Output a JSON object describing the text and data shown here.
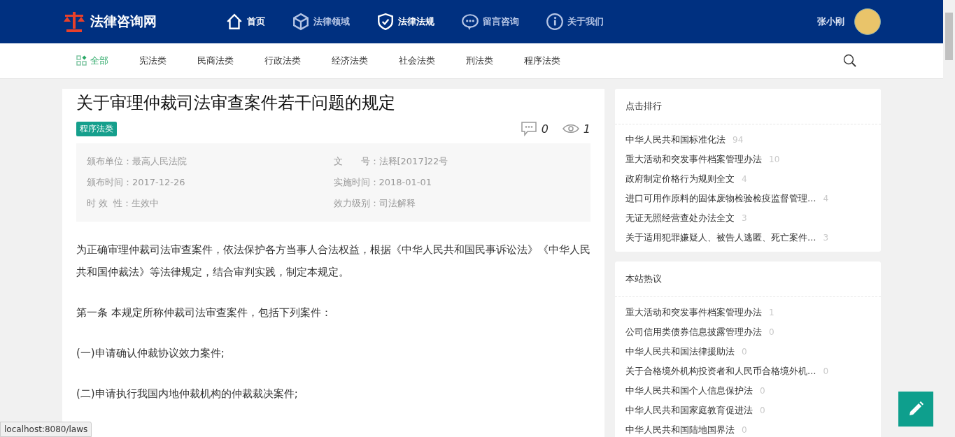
{
  "header": {
    "logo": "法律咨询网",
    "nav": [
      {
        "label": "首页",
        "selected": true
      },
      {
        "label": "法律领域",
        "selected": false
      },
      {
        "label": "法律法规",
        "selected": true
      },
      {
        "label": "留言咨询",
        "selected": false
      },
      {
        "label": "关于我们",
        "selected": false
      }
    ],
    "user": "张小刚"
  },
  "categories": [
    {
      "label": "全部",
      "selected": true
    },
    {
      "label": "宪法类",
      "selected": false
    },
    {
      "label": "民商法类",
      "selected": false
    },
    {
      "label": "行政法类",
      "selected": false
    },
    {
      "label": "经济法类",
      "selected": false
    },
    {
      "label": "社会法类",
      "selected": false
    },
    {
      "label": "刑法类",
      "selected": false
    },
    {
      "label": "程序法类",
      "selected": false
    }
  ],
  "article": {
    "title": "关于审理仲裁司法审查案件若干问题的规定",
    "tag": "程序法类",
    "comments": "0",
    "views": "1",
    "info": [
      {
        "label": "颁布单位：",
        "value": "最高人民法院"
      },
      {
        "label": "文　　号：",
        "value": "法释[2017]22号"
      },
      {
        "label": "颁布时间：",
        "value": "2017-12-26"
      },
      {
        "label": "实施时间：",
        "value": "2018-01-01"
      },
      {
        "label": "时 效  性：",
        "value": "生效中"
      },
      {
        "label": "效力级别：",
        "value": "司法解释"
      }
    ],
    "paragraphs": [
      "为正确审理仲裁司法审查案件，依法保护各方当事人合法权益，根据《中华人民共和国民事诉讼法》《中华人民共和国仲裁法》等法律规定，结合审判实践，制定本规定。",
      "第一条 本规定所称仲裁司法审查案件，包括下列案件：",
      "(一)申请确认仲裁协议效力案件;",
      "(二)申请执行我国内地仲裁机构的仲裁裁决案件;"
    ]
  },
  "sidebar": [
    {
      "title": "点击排行",
      "items": [
        {
          "title": "中华人民共和国标准化法",
          "count": "94"
        },
        {
          "title": "重大活动和突发事件档案管理办法",
          "count": "10"
        },
        {
          "title": "政府制定价格行为规则全文",
          "count": "4"
        },
        {
          "title": "进口可用作原料的固体废物检验检疫监督管理…",
          "count": "4"
        },
        {
          "title": "无证无照经营查处办法全文",
          "count": "3"
        },
        {
          "title": "关于适用犯罪嫌疑人、被告人逃匿、死亡案件…",
          "count": "3"
        }
      ]
    },
    {
      "title": "本站热议",
      "items": [
        {
          "title": "重大活动和突发事件档案管理办法",
          "count": "1"
        },
        {
          "title": "公司信用类债券信息披露管理办法",
          "count": "0"
        },
        {
          "title": "中华人民共和国法律援助法",
          "count": "0"
        },
        {
          "title": "关于合格境外机构投资者和人民币合格境外机…",
          "count": "0"
        },
        {
          "title": "中华人民共和国个人信息保护法",
          "count": "0"
        },
        {
          "title": "中华人民共和国家庭教育促进法",
          "count": "0"
        },
        {
          "title": "中华人民共和国陆地国界法",
          "count": "0"
        }
      ]
    }
  ],
  "status_bar": "localhost:8080/laws"
}
